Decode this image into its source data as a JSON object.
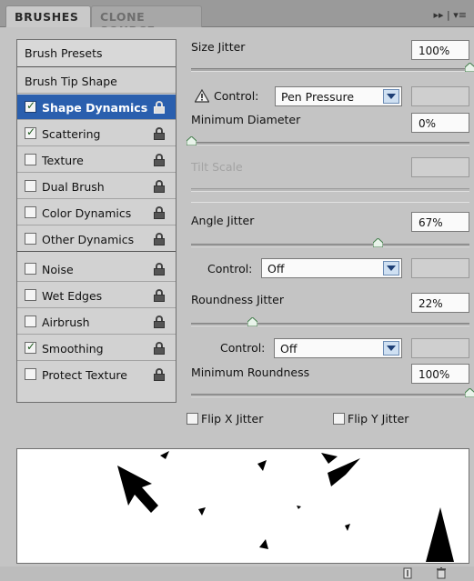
{
  "tabs": [
    {
      "label": "BRUSHES",
      "active": true
    },
    {
      "label": "CLONE SOURCE",
      "active": false
    }
  ],
  "tabbar_icons": "▸▸ | ▾≡",
  "sidebar": {
    "items": [
      {
        "label": "Brush Presets",
        "checkbox": false,
        "checked": false,
        "lock": false
      },
      {
        "label": "Brush Tip Shape",
        "checkbox": false,
        "checked": false,
        "lock": false
      },
      {
        "label": "Shape Dynamics",
        "checkbox": true,
        "checked": true,
        "selected": true,
        "lock": true
      },
      {
        "label": "Scattering",
        "checkbox": true,
        "checked": true,
        "lock": true
      },
      {
        "label": "Texture",
        "checkbox": true,
        "checked": false,
        "lock": true
      },
      {
        "label": "Dual Brush",
        "checkbox": true,
        "checked": false,
        "lock": true
      },
      {
        "label": "Color Dynamics",
        "checkbox": true,
        "checked": false,
        "lock": true
      },
      {
        "label": "Other Dynamics",
        "checkbox": true,
        "checked": false,
        "lock": true
      },
      {
        "label": "Noise",
        "checkbox": true,
        "checked": false,
        "lock": true
      },
      {
        "label": "Wet Edges",
        "checkbox": true,
        "checked": false,
        "lock": true
      },
      {
        "label": "Airbrush",
        "checkbox": true,
        "checked": false,
        "lock": true
      },
      {
        "label": "Smoothing",
        "checkbox": true,
        "checked": true,
        "lock": true
      },
      {
        "label": "Protect Texture",
        "checkbox": true,
        "checked": false,
        "lock": true
      }
    ]
  },
  "settings": {
    "size_jitter": {
      "label": "Size Jitter",
      "value": "100%",
      "fraction": 1.0
    },
    "control1": {
      "label": "Control:",
      "value": "Pen Pressure"
    },
    "min_diameter": {
      "label": "Minimum Diameter",
      "value": "0%",
      "fraction": 0.0
    },
    "tilt_scale": {
      "label": "Tilt Scale",
      "value": ""
    },
    "angle_jitter": {
      "label": "Angle Jitter",
      "value": "67%",
      "fraction": 0.67
    },
    "control2": {
      "label": "Control:",
      "value": "Off"
    },
    "roundness_jitter": {
      "label": "Roundness Jitter",
      "value": "22%",
      "fraction": 0.22
    },
    "control3": {
      "label": "Control:",
      "value": "Off"
    },
    "min_roundness": {
      "label": "Minimum Roundness",
      "value": "100%",
      "fraction": 1.0
    },
    "flip_x": {
      "label": "Flip X Jitter",
      "checked": false
    },
    "flip_y": {
      "label": "Flip Y Jitter",
      "checked": false
    }
  },
  "icons": {
    "warning": "warning-icon",
    "lock": "lock-icon",
    "dropdown": "chevron-down-icon",
    "new_brush": "new-brush-icon",
    "trash": "trash-icon"
  },
  "colors": {
    "selection": "#2a5fae",
    "panel": "#c4c4c4",
    "dropdown_arrow": "#cfe0f2"
  }
}
